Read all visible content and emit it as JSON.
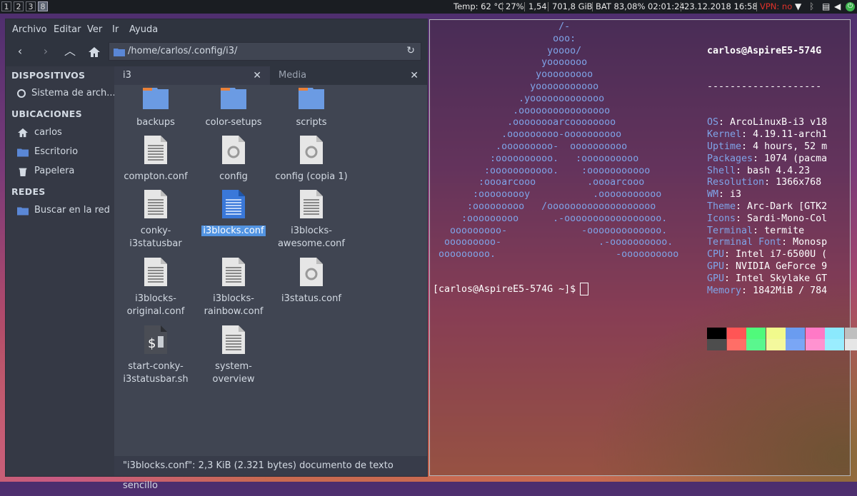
{
  "topbar": {
    "workspaces": [
      "1",
      "2",
      "3",
      "8"
    ],
    "active_workspace": "8",
    "temp": "Temp: 62 °C",
    "cpu": "27%",
    "load": "1,54",
    "disk": "701,8 GiB",
    "battery": "BAT 83,08% 02:01:24",
    "datetime": "23.12.2018 16:58",
    "vpn": "VPN: no",
    "vpn_color": "#e0322a",
    "tray_icons": [
      "wifi-icon",
      "bluetooth-icon",
      "clipboard-icon",
      "volume-icon",
      "power-icon"
    ]
  },
  "filemanager": {
    "menu": [
      "Archivo",
      "Editar",
      "Ver",
      "Ir",
      "Ayuda"
    ],
    "location": "/home/carlos/.config/i3/",
    "sidebar": {
      "sections": [
        {
          "title": "DISPOSITIVOS",
          "items": [
            {
              "label": "Sistema de arch...",
              "icon": "disk-icon"
            }
          ]
        },
        {
          "title": "UBICACIONES",
          "items": [
            {
              "label": "carlos",
              "icon": "home-icon"
            },
            {
              "label": "Escritorio",
              "icon": "desktop-folder-icon"
            },
            {
              "label": "Papelera",
              "icon": "trash-icon"
            }
          ]
        },
        {
          "title": "REDES",
          "items": [
            {
              "label": "Buscar en la red",
              "icon": "network-icon"
            }
          ]
        }
      ]
    },
    "tabs": [
      {
        "label": "i3",
        "active": true
      },
      {
        "label": "Media",
        "active": false
      }
    ],
    "files": [
      {
        "name": "backups",
        "type": "folder"
      },
      {
        "name": "color-setups",
        "type": "folder"
      },
      {
        "name": "scripts",
        "type": "folder"
      },
      {
        "name": "compton.conf",
        "type": "text"
      },
      {
        "name": "config",
        "type": "config"
      },
      {
        "name": "config (copia 1)",
        "type": "config"
      },
      {
        "name": "conky-i3statusbar",
        "type": "text"
      },
      {
        "name": "i3blocks.conf",
        "type": "text-selected",
        "selected": true
      },
      {
        "name": "i3blocks-awesome.conf",
        "type": "text"
      },
      {
        "name": "i3blocks-original.conf",
        "type": "text"
      },
      {
        "name": "i3blocks-rainbow.conf",
        "type": "text"
      },
      {
        "name": "i3status.conf",
        "type": "config"
      },
      {
        "name": "start-conky-i3statusbar.sh",
        "type": "script"
      },
      {
        "name": "system-overview",
        "type": "text"
      }
    ],
    "status": "\"i3blocks.conf\": 2,3 KiB (2.321 bytes) documento de texto sencillo"
  },
  "terminal": {
    "ascii_art": "                      /-\n                     ooo:\n                    yoooo/\n                   yooooooo\n                  yooooooooo\n                 yooooooooooo\n               .yooooooooooooo\n              .oooooooooooooooo\n             .oooooooarcoooooooo\n            .ooooooooo-oooooooooo\n           .ooooooooo-  oooooooooo\n          :oooooooooo.   :oooooooooo\n         :ooooooooooo.    :ooooooooooo\n        :oooarcooo         .oooarcooo\n       :ooooooooy           .ooooooooooo\n      :ooooooooo   /ooooooooooooooooooo\n     :ooooooooo      .-ooooooooooooooooo.\n   ooooooooo-             -ooooooooooooo.\n  ooooooooo-                 .-oooooooooo.\n ooooooooo.                     -oooooooooo",
    "user_host": "carlos@AspireE5-574G",
    "separator": "--------------------",
    "info": [
      {
        "key": "OS",
        "value": " ArcoLinuxB-i3 v18"
      },
      {
        "key": "Kernel",
        "value": " 4.19.11-arch1"
      },
      {
        "key": "Uptime",
        "value": " 4 hours, 52 m"
      },
      {
        "key": "Packages",
        "value": " 1074 (pacma"
      },
      {
        "key": "Shell",
        "value": " bash 4.4.23"
      },
      {
        "key": "Resolution",
        "value": " 1366x768"
      },
      {
        "key": "WM",
        "value": " i3"
      },
      {
        "key": "Theme",
        "value": " Arc-Dark [GTK2"
      },
      {
        "key": "Icons",
        "value": " Sardi-Mono-Col"
      },
      {
        "key": "Terminal",
        "value": " termite"
      },
      {
        "key": "Terminal Font",
        "value": " Monosp"
      },
      {
        "key": "CPU",
        "value": " Intel i7-6500U ("
      },
      {
        "key": "GPU",
        "value": " NVIDIA GeForce 9"
      },
      {
        "key": "GPU",
        "value": " Intel Skylake GT"
      },
      {
        "key": "Memory",
        "value": " 1842MiB / 784"
      }
    ],
    "palette_top": [
      "#000000",
      "#ff5555",
      "#50fa7b",
      "#f1fa8c",
      "#6a9cf0",
      "#ff79c6",
      "#8be9fd",
      "#bfbfbf"
    ],
    "palette_bottom": [
      "#4d4d4d",
      "#ff6e67",
      "#5af78e",
      "#f4f99d",
      "#7aa6f5",
      "#ff92d0",
      "#9aedfe",
      "#e6e6e6"
    ],
    "prompt": "[carlos@AspireE5-574G ~]$"
  }
}
